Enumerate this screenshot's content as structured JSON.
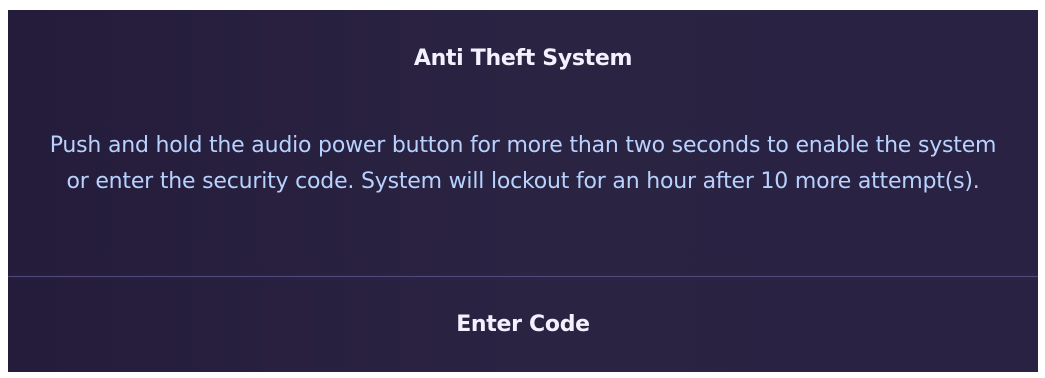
{
  "dialog": {
    "title": "Anti Theft System",
    "message": "Push and hold the audio power button for more than two seconds to enable the system or enter the security code. System will lockout for an hour after 10 more attempt(s).",
    "enter_code_label": "Enter Code"
  },
  "colors": {
    "background": "#2a2242",
    "title_text": "#f3f1ff",
    "message_text": "#b7d2ff"
  }
}
